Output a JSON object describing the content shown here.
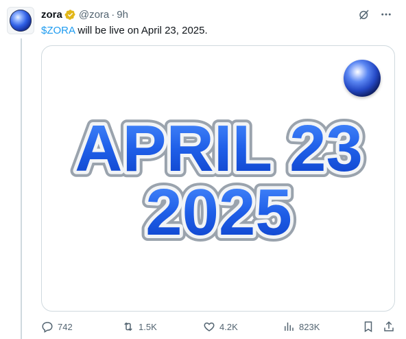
{
  "post": {
    "author_name": "zora",
    "handle": "@zora",
    "separator": "·",
    "time": "9h",
    "text_cashtag": "$ZORA",
    "text_rest": " will be live on April 23, 2025.",
    "image_text_line1": "APRIL 23",
    "image_text_line2": "2025"
  },
  "stats": {
    "replies": "742",
    "reposts": "1.5K",
    "likes": "4.2K",
    "views": "823K"
  },
  "colors": {
    "link": "#1d9bf0",
    "muted": "#536471",
    "verified_gold": "#e2b719",
    "image_blue": "#2f6df0"
  },
  "icons": {
    "verified": "verified-badge-icon",
    "grok": "grok-icon",
    "more": "more-icon",
    "reply": "reply-icon",
    "repost": "repost-icon",
    "like": "like-icon",
    "views": "views-icon",
    "bookmark": "bookmark-icon",
    "share": "share-icon"
  }
}
